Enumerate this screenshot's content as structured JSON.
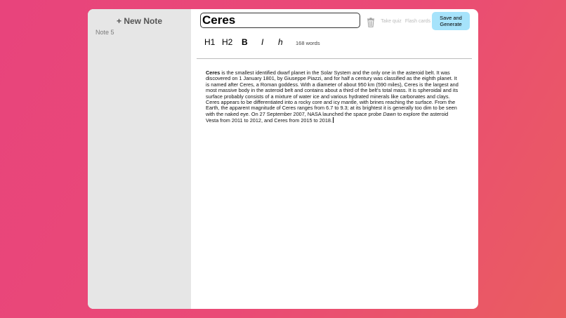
{
  "sidebar": {
    "new_note_label": "+ New Note",
    "notes": [
      {
        "label": "Note 5"
      }
    ]
  },
  "editor": {
    "title_value": "Ceres",
    "word_count": "168 words",
    "content": {
      "bold_lead": "Ceres",
      "text_1": " is the smallest identified dwarf planet in the Solar System and the only one in the asteroid belt. It was discovered on 1 January 1801, by Giuseppe Piazzi, and for half a century was classified as the eighth planet. It is named after Ceres, a Roman goddess. With a diameter of about 950 km (590 miles), Ceres is the largest and most massive body in the asteroid belt and contains about a third of the belt's total mass. It is spheroidal and its surface probably consists of a mixture of water ice and various hydrated minerals like carbonates and clays. Ceres appears to be differentiated into a rocky core and icy mantle, with brines reaching the surface. From the Earth, the apparent magnitude of Ceres ranges from 6.7 to 9.3; at its brightest it is generally too dim to be seen with the naked eye. On 27 September 2007, NASA launched the space probe ",
      "italic": "Dawn",
      "text_2": " to explore the asteroid Vesta from 2011 to 2012, and Ceres from 2015 to 2018."
    }
  },
  "toolbar": {
    "take_quiz_label": "Take quiz",
    "flash_cards_label": "Flash cards",
    "save_label": "Save and Generate",
    "h1_label": "H1",
    "h2_label": "H2",
    "bold_label": "B",
    "italic_label": "I",
    "h_label": "h"
  },
  "colors": {
    "save_button": "#a6e3fb",
    "sidebar": "#e6e6e6",
    "background_start": "#e8447c",
    "background_end": "#ea5d60"
  },
  "icons": {
    "trash": "trash-icon"
  }
}
